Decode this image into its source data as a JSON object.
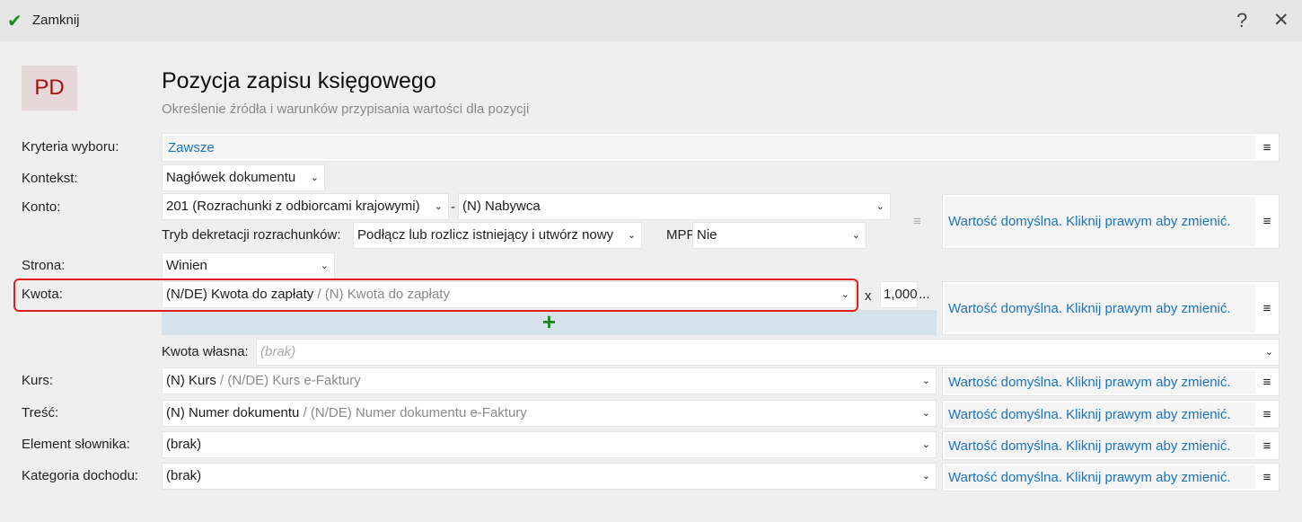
{
  "topbar": {
    "close_label": "Zamknij",
    "help": "?",
    "close_x": "✕"
  },
  "header": {
    "badge": "PD",
    "title": "Pozycja zapisu księgowego",
    "subtitle": "Określenie źródła i warunków przypisania wartości dla pozycji"
  },
  "fields": {
    "kryteria": {
      "label": "Kryteria wyboru:",
      "value": "Zawsze"
    },
    "kontekst": {
      "label": "Kontekst:",
      "value": "Nagłówek dokumentu"
    },
    "konto": {
      "label": "Konto:",
      "value": "201 (Rozrachunki z odbiorcami krajowymi)",
      "sep": "-",
      "sub_value": "(N) Nabywca"
    },
    "tryb": {
      "label": "Tryb dekretacji rozrachunków:",
      "value": "Podłącz lub rozlicz istniejący i utwórz nowy"
    },
    "mpp": {
      "label": "MPP:",
      "value": "Nie"
    },
    "strona": {
      "label": "Strona:",
      "value": "Winien"
    },
    "kwota": {
      "label": "Kwota:",
      "value": "(N/DE) Kwota do zapłaty",
      "alt": "/ (N) Kwota do zapłaty",
      "times": "x",
      "multiplier": "1,000",
      "more": "...",
      "add": "+"
    },
    "kwota_wlasna": {
      "label": "Kwota własna:",
      "value": "(brak)"
    },
    "kurs": {
      "label": "Kurs:",
      "value": "(N) Kurs",
      "alt": "/ (N/DE) Kurs e-Faktury"
    },
    "tresc": {
      "label": "Treść:",
      "value": "(N) Numer dokumentu",
      "alt": "/ (N/DE) Numer dokumentu e-Faktury"
    },
    "element": {
      "label": "Element słownika:",
      "value": "(brak)"
    },
    "kategoria": {
      "label": "Kategoria dochodu:",
      "value": "(brak)"
    }
  },
  "default_text": "Wartość domyślna. Kliknij prawym aby zmienić.",
  "colors": {
    "accent": "#1a73c0",
    "highlight": "#e02020",
    "badge_bg": "#e6d8d8",
    "badge_fg": "#a01010"
  }
}
